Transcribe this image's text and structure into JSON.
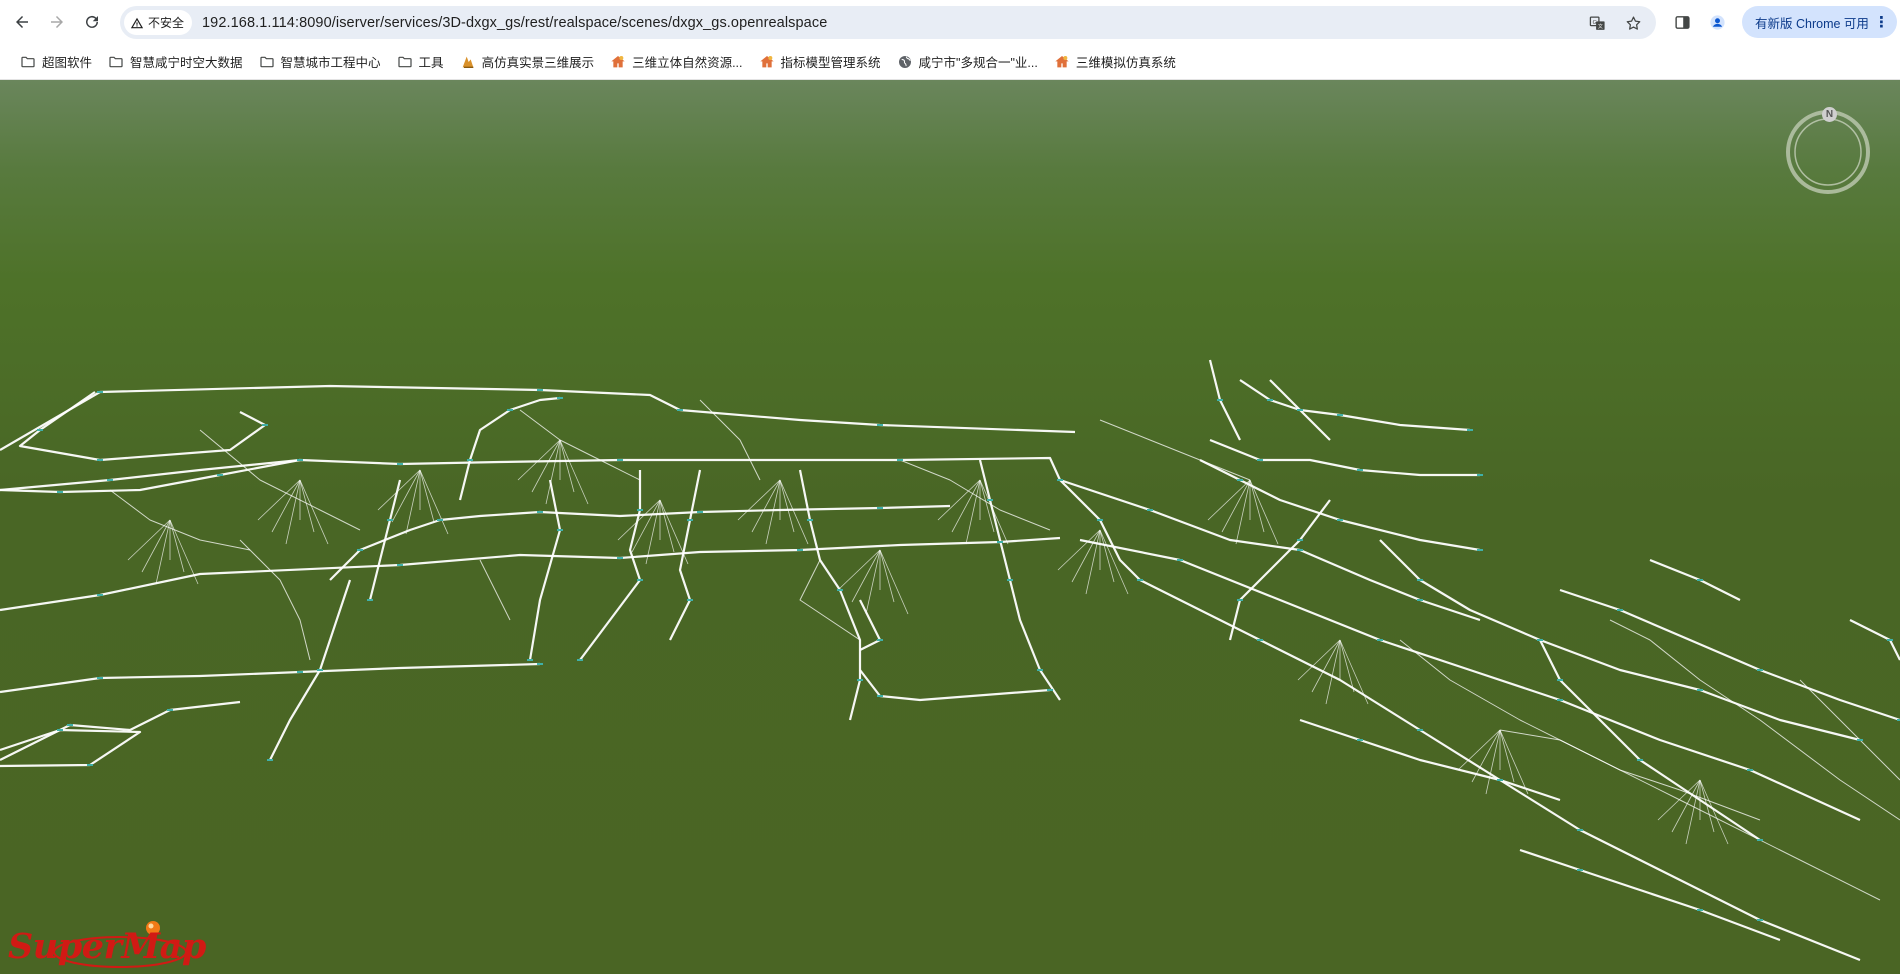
{
  "browser": {
    "security_label": "不安全",
    "url": "192.168.1.114:8090/iserver/services/3D-dxgx_gs/rest/realspace/scenes/dxgx_gs.openrealspace",
    "update_label": "有新版 Chrome 可用",
    "icons": {
      "back": "back-arrow-icon",
      "forward": "forward-arrow-icon",
      "reload": "reload-icon",
      "warning": "warning-icon",
      "translate": "translate-icon",
      "bookmark_star": "star-icon",
      "side_panel": "side-panel-icon",
      "profile": "profile-icon",
      "menu": "kebab-menu-icon"
    }
  },
  "bookmarks": [
    {
      "label": "超图软件",
      "icon": "folder-icon"
    },
    {
      "label": "智慧咸宁时空大数据",
      "icon": "folder-icon"
    },
    {
      "label": "智慧城市工程中心",
      "icon": "folder-icon"
    },
    {
      "label": "工具",
      "icon": "folder-icon"
    },
    {
      "label": "高仿真实景三维展示",
      "icon": "favicon-orange-icon"
    },
    {
      "label": "三维立体自然资源...",
      "icon": "favicon-house-icon"
    },
    {
      "label": "指标模型管理系统",
      "icon": "favicon-house-icon"
    },
    {
      "label": "咸宁市\"多规合一\"业...",
      "icon": "globe-icon"
    },
    {
      "label": "三维模拟仿真系统",
      "icon": "favicon-house-icon"
    }
  ],
  "scene": {
    "compass_label": "N",
    "logo_text": "SuperMap",
    "colors": {
      "sky_top": "#6a865c",
      "ground": "#4a6524",
      "pipe_line": "#ffffff",
      "pipe_node": "#3fb0a8"
    }
  }
}
